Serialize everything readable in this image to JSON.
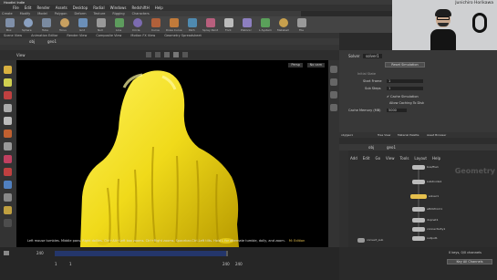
{
  "app": {
    "title": "Houdini Indie"
  },
  "menu": [
    "File",
    "Edit",
    "Render",
    "Assets",
    "Desktop",
    "Radial",
    "Windows",
    "RedshiftH",
    "Help"
  ],
  "shelf_tabs": [
    "Create",
    "Modify",
    "Model",
    "Polygon",
    "Deform",
    "Texture",
    "Rigging",
    "Characters"
  ],
  "shelf_tools": [
    "Box",
    "Sphere",
    "Tube",
    "Torus",
    "Grid",
    "Null",
    "Line",
    "Circle",
    "Curve",
    "Draw Curve",
    "Path",
    "Spray Paint",
    "Font",
    "Platonic",
    "L-System",
    "Metaball",
    "File"
  ],
  "pane_tabs": [
    "Scene View",
    "Animation Editor",
    "Render View",
    "Composite View",
    "Motion FX View",
    "Geometry Spreadsheet"
  ],
  "viewport": {
    "path_node": "obj",
    "path_geo": "geo1",
    "title": "View",
    "persp_label": "Persp",
    "cam_label": "No cam",
    "status_text": "Left mouse tumbles. Middle pans. Right dollies. Ctrl+Alt+Left box zooms. Ctrl+Right zooms. Spacebar-Ctrl-Left tilts. Hold L for alternate tumble, dolly, and zoom.",
    "status_mode": "M: Edition"
  },
  "timeline": {
    "frame": "240",
    "start": "1",
    "end": "240",
    "range_end": "240",
    "current": "1"
  },
  "webcam": {
    "name": "Junichiro Horikawa"
  },
  "params": {
    "node_type": "Solver",
    "node_name": "solver1",
    "tab": "Reset Simulation",
    "section": "Initial State",
    "rows": [
      {
        "label": "Start Frame",
        "value": "1"
      },
      {
        "label": "Sub Steps",
        "value": "1"
      }
    ],
    "cache_sim": "Cache Simulation",
    "cache_disk": "Allow Caching To Disk",
    "cache_mem_label": "Cache Memory (MB)",
    "cache_mem_value": "5000"
  },
  "network": {
    "tabs": [
      "obj/geo1",
      "Tree View",
      "Material Palette",
      "Asset Browser"
    ],
    "path_node": "obj",
    "path_geo": "geo1",
    "menu": [
      "Add",
      "Edit",
      "Go",
      "View",
      "Tools",
      "Layout",
      "Help"
    ],
    "watermark": "Geometry",
    "nodes": [
      "box/file1",
      "subdivide1",
      "solver1",
      "attribfrom1",
      "dopnet1",
      "connectivity1",
      "output1"
    ],
    "bottom_node": "convert_sub"
  },
  "bottom_right": {
    "key_info": "0 keys, 0/0 channels",
    "key_btn": "Key All Channels"
  }
}
